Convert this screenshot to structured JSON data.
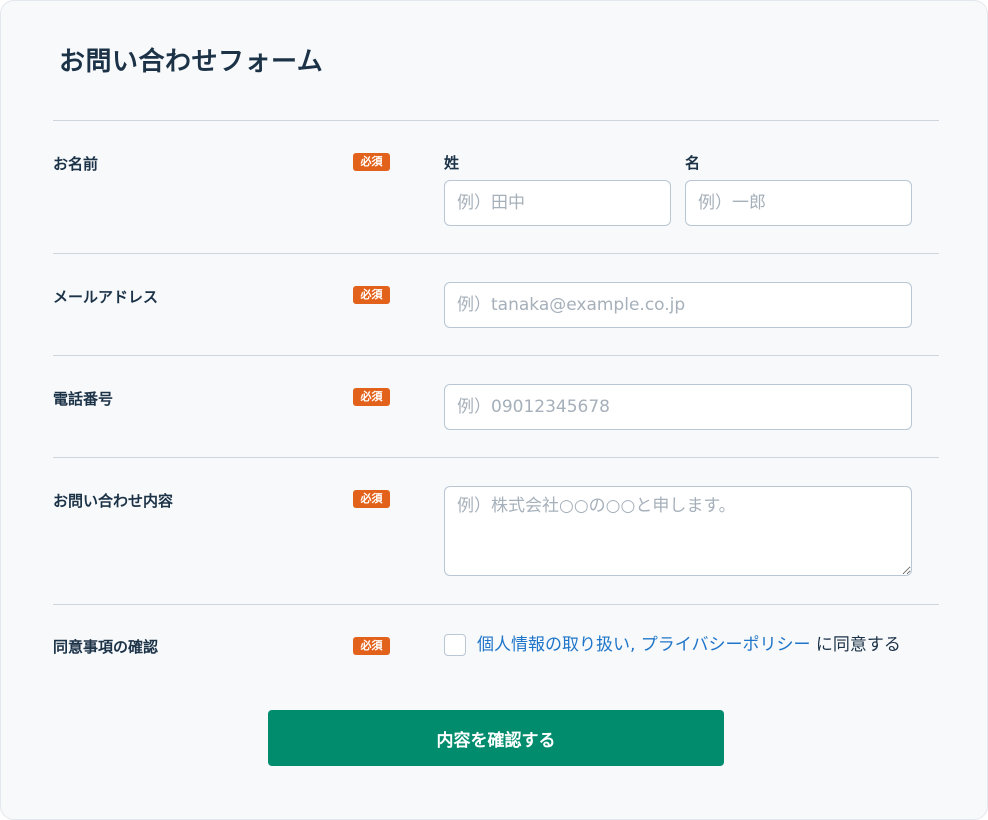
{
  "form": {
    "title": "お問い合わせフォーム",
    "required_label": "必須",
    "name": {
      "label": "お名前",
      "last_label": "姓",
      "last_placeholder": "例）田中",
      "first_label": "名",
      "first_placeholder": "例）一郎"
    },
    "email": {
      "label": "メールアドレス",
      "placeholder": "例）tanaka@example.co.jp"
    },
    "phone": {
      "label": "電話番号",
      "placeholder": "例）09012345678"
    },
    "inquiry": {
      "label": "お問い合わせ内容",
      "placeholder": "例）株式会社○○の○○と申します。"
    },
    "consent": {
      "label": "同意事項の確認",
      "link_text": "個人情報の取り扱い, プライバシーポリシー",
      "suffix": "に同意する"
    },
    "submit_label": "内容を確認する"
  },
  "colors": {
    "accent": "#008c6d",
    "badge": "#e3621b",
    "link": "#1f75c9",
    "text": "#1c3247"
  }
}
